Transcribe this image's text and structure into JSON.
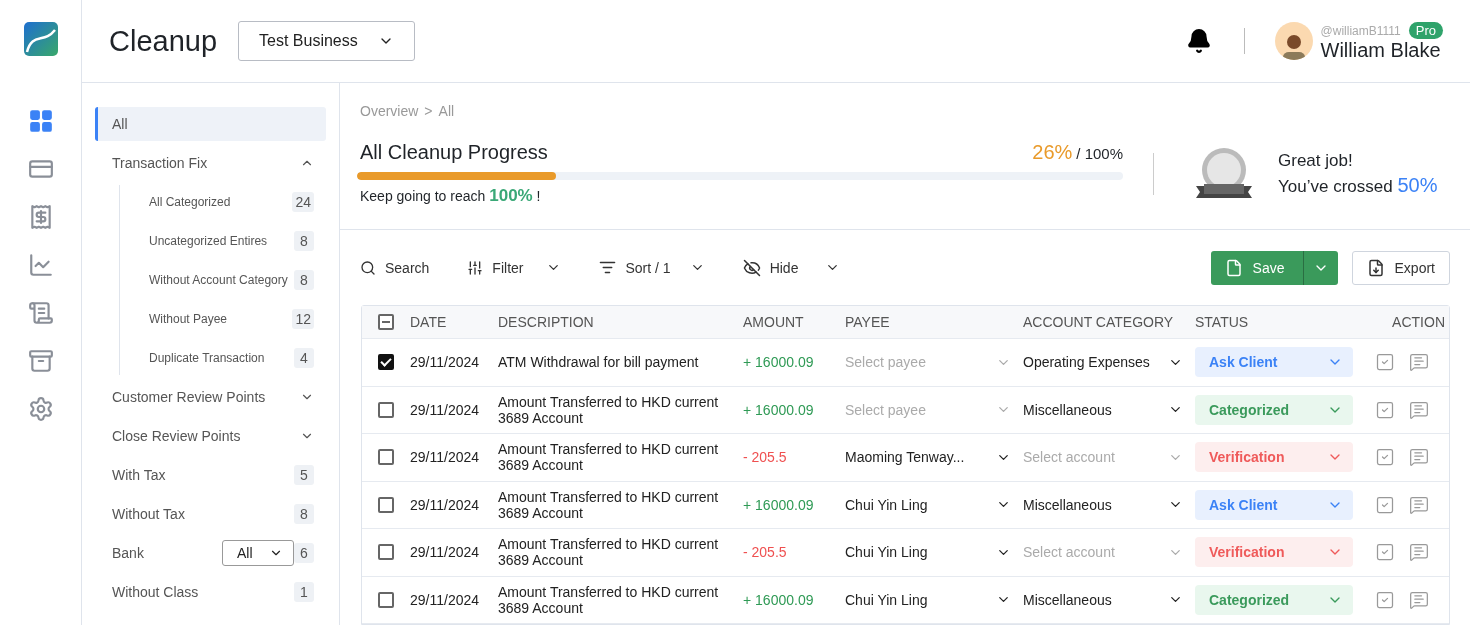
{
  "header": {
    "title": "Cleanup",
    "business_select": {
      "value": "Test Business"
    },
    "user": {
      "handle": "@williamB1111",
      "badge": "Pro",
      "name": "William Blake"
    }
  },
  "rail": [
    {
      "kind": "grid",
      "selected": true
    },
    {
      "kind": "cards",
      "selected": false
    },
    {
      "kind": "billing",
      "selected": false
    },
    {
      "kind": "chart",
      "selected": false
    },
    {
      "kind": "report",
      "selected": false
    },
    {
      "kind": "archive",
      "selected": false
    },
    {
      "kind": "settings",
      "selected": false
    }
  ],
  "sidebar": {
    "items": [
      {
        "label": "All",
        "selected": true
      },
      {
        "label": "Transaction Fix",
        "selected": false,
        "expanded": true,
        "children": [
          {
            "label": "All Categorized",
            "count": "24",
            "selected": false
          },
          {
            "label": "Uncategorized Entires",
            "count": "8",
            "selected": false
          },
          {
            "label": "Without Account Category",
            "count": "8",
            "selected": false
          },
          {
            "label": "Without Payee",
            "count": "12",
            "selected": false
          },
          {
            "label": "Duplicate Transaction",
            "count": "4",
            "selected": false
          }
        ]
      },
      {
        "label": "Customer Review Points",
        "selected": false,
        "expanded": false
      },
      {
        "label": "Close Review Points",
        "selected": false,
        "expanded": false
      },
      {
        "label": "With Tax",
        "count": "5",
        "selected": false
      },
      {
        "label": "Without Tax",
        "count": "8",
        "selected": false
      },
      {
        "label": "Bank",
        "count": "6",
        "select": "All",
        "selected": false
      },
      {
        "label": "Without Class",
        "count": "1",
        "selected": false
      }
    ]
  },
  "breadcrumb": {
    "items": [
      "Overview",
      "All"
    ],
    "separator": ">"
  },
  "progress": {
    "title": "All Cleanup Progress",
    "percent": "26%",
    "total": "/ 100%",
    "level": 0.26,
    "hint": "Keep going to reach **100%** !",
    "message": "Great job!",
    "crossed_text": "You’ve crossed",
    "crossed_value": "50%"
  },
  "toolbar": {
    "search": "Search",
    "filter": "Filter",
    "sort": "Sort / 1",
    "hide": "Hide",
    "save": "Save",
    "export": "Export"
  },
  "table": {
    "select_all_indeterminate": true,
    "columns": [
      "DATE",
      "DESCRIPTION",
      "AMOUNT",
      "PAYEE",
      "ACCOUNT CATEGORY",
      "STATUS",
      "ACTION"
    ],
    "rows": [
      {
        "checked": true,
        "date": "29/11/2024",
        "description": "ATM Withdrawal for bill payment",
        "amount": "+ 16000.09",
        "negative": false,
        "payee": {
          "placeholder": "Select payee"
        },
        "account": {
          "value": "Operating Expenses"
        },
        "status": {
          "label": "Ask Client",
          "kind": "ask"
        }
      },
      {
        "checked": false,
        "date": "29/11/2024",
        "description": "Amount Transferred to HKD current 3689 Account",
        "amount": "+ 16000.09",
        "negative": false,
        "payee": {
          "placeholder": "Select payee"
        },
        "account": {
          "value": "Miscellaneous"
        },
        "status": {
          "label": "Categorized",
          "kind": "categorized"
        }
      },
      {
        "checked": false,
        "date": "29/11/2024",
        "description": "Amount Transferred to HKD current 3689 Account",
        "amount": "- 205.5",
        "negative": true,
        "payee": {
          "value": "Maoming Tenway..."
        },
        "account": {
          "placeholder": "Select account"
        },
        "status": {
          "label": "Verification",
          "kind": "verification"
        }
      },
      {
        "checked": false,
        "date": "29/11/2024",
        "description": "Amount Transferred to HKD current 3689 Account",
        "amount": "+ 16000.09",
        "negative": false,
        "payee": {
          "value": "Chui Yin Ling"
        },
        "account": {
          "value": "Miscellaneous"
        },
        "status": {
          "label": "Ask Client",
          "kind": "ask"
        }
      },
      {
        "checked": false,
        "date": "29/11/2024",
        "description": "Amount Transferred to HKD current 3689 Account",
        "amount": "- 205.5",
        "negative": true,
        "payee": {
          "value": "Chui Yin Ling"
        },
        "account": {
          "placeholder": "Select account"
        },
        "status": {
          "label": "Verification",
          "kind": "verification"
        }
      },
      {
        "checked": false,
        "date": "29/11/2024",
        "description": "Amount Transferred to HKD current 3689 Account",
        "amount": "+ 16000.09",
        "negative": false,
        "payee": {
          "value": "Chui Yin Ling"
        },
        "account": {
          "value": "Miscellaneous"
        },
        "status": {
          "label": "Categorized",
          "kind": "categorized"
        }
      }
    ]
  }
}
